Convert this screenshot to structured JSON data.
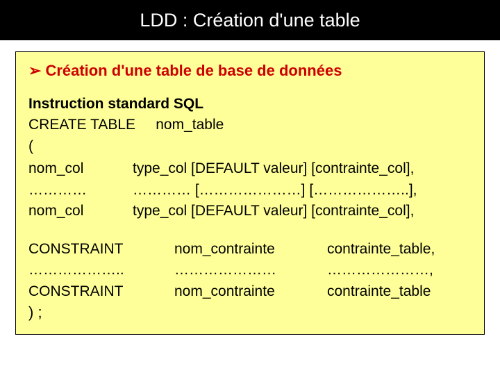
{
  "title": "LDD : Création d'une table",
  "heading": "Création d'une table de base de données",
  "sql": {
    "line1": "Instruction standard SQL",
    "line2a": "CREATE TABLE",
    "line2b": "     nom_table",
    "paren_open": "(",
    "columns": [
      {
        "name": "nom_col",
        "def": "type_col  [DEFAULT valeur] [contrainte_col],"
      },
      {
        "name": "…………",
        "def": "………… […………………] [………………..],"
      },
      {
        "name": "nom_col",
        "def": "type_col  [DEFAULT valeur] [contrainte_col],"
      }
    ],
    "constraints": [
      {
        "kw": "CONSTRAINT",
        "name": "nom_contrainte",
        "def": "contrainte_table,"
      },
      {
        "kw": "………………..",
        "name": "…………………",
        "def": "…………………,"
      },
      {
        "kw": "CONSTRAINT",
        "name": "nom_contrainte",
        "def": "contrainte_table"
      }
    ],
    "closer": ") ;"
  }
}
